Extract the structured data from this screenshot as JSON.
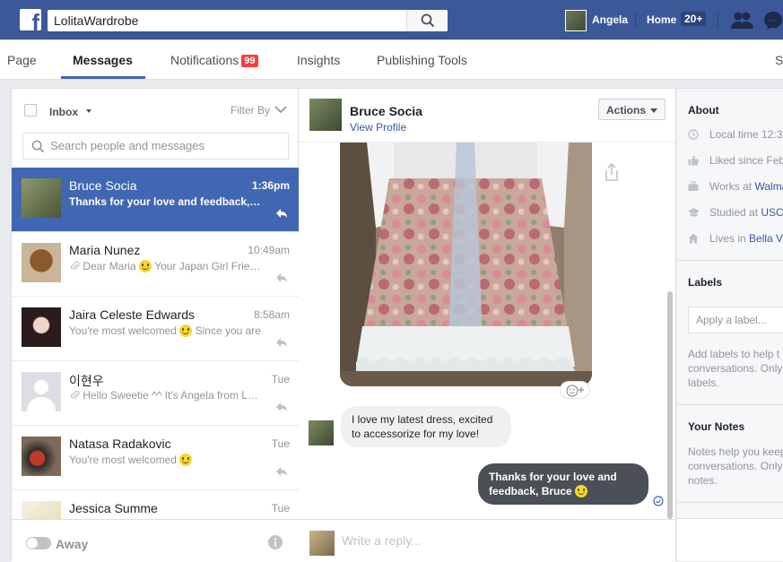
{
  "topbar": {
    "logo": "f",
    "search_value": "LolitaWardrobe",
    "user_name": "Angela",
    "home_label": "Home",
    "home_count": "20+"
  },
  "tabs": {
    "page": "Page",
    "messages": "Messages",
    "notifications": "Notifications",
    "notifications_count": "99",
    "insights": "Insights",
    "publishing_tools": "Publishing Tools",
    "settings_partial": "S"
  },
  "inbox": {
    "label": "Inbox",
    "filter_label": "Filter By",
    "search_placeholder": "Search people and messages",
    "conversations": [
      {
        "name": "Bruce Socia",
        "time": "1:36pm",
        "snippet": "Thanks for your love and feedback, Bruce",
        "selected": true
      },
      {
        "name": "Maria Nunez",
        "time": "10:49am",
        "snippet_pre": "Dear Maria",
        "snippet_post": "Your Japan Girl Friends",
        "has_attach": true
      },
      {
        "name": "Jaira Celeste Edwards",
        "time": "8:58am",
        "snippet_pre": "You're most welcomed",
        "snippet_post": "Since you are"
      },
      {
        "name": "이현우",
        "time": "Tue",
        "snippet": "Hello Sweetie ^^ It's Angela from Lolita",
        "has_attach": true
      },
      {
        "name": "Natasa Radakovic",
        "time": "Tue",
        "snippet_pre": "You're most welcomed",
        "snippet_post": ""
      },
      {
        "name": "Jessica Summe",
        "time": "Tue",
        "snippet": ""
      }
    ],
    "away_label": "Away"
  },
  "thread": {
    "name": "Bruce Socia",
    "view_profile": "View Profile",
    "actions_label": "Actions",
    "incoming_message": "I love my latest dress,  excited to accessorize for my love!",
    "outgoing_message": "Thanks for your love and feedback, Bruce",
    "reply_placeholder": "Write a reply..."
  },
  "about": {
    "title": "About",
    "rows": [
      {
        "icon": "clock-icon",
        "text": "Local time 12:3"
      },
      {
        "icon": "thumbs-up-icon",
        "text": "Liked since Feb"
      },
      {
        "icon": "briefcase-icon",
        "pre": "Works at ",
        "link": "Walma"
      },
      {
        "icon": "graduation-cap-icon",
        "pre": "Studied at ",
        "link": "USC"
      },
      {
        "icon": "home-icon",
        "pre": "Lives in ",
        "link": "Bella V"
      }
    ],
    "labels_title": "Labels",
    "labels_placeholder": "Apply a label...",
    "labels_help": "Add labels to help t conversations. Only labels.",
    "notes_title": "Your Notes",
    "notes_help": "Notes help you keep conversations. Only notes."
  },
  "colors": {
    "brand_blue": "#3b5998",
    "selected_row": "#4267b2",
    "badge_red": "#fa3e3e",
    "outgoing_bubble": "#4b4f56"
  }
}
